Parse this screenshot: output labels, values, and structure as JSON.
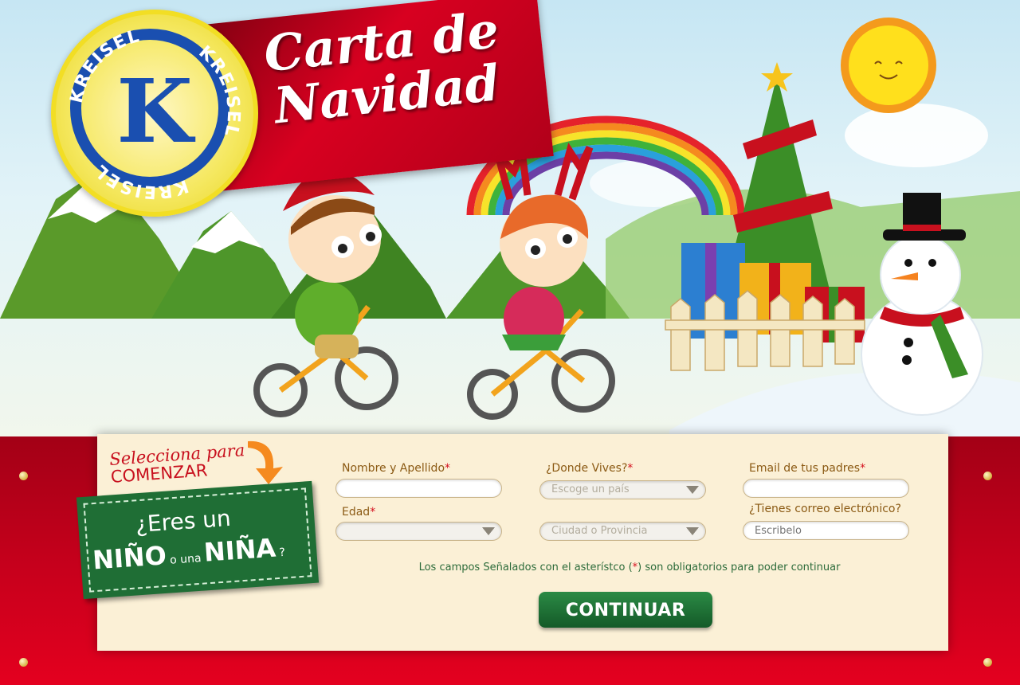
{
  "header": {
    "title_line1": "Carta de",
    "title_line2": "Navidad",
    "logo_text": "KREISEL",
    "logo_letter": "K"
  },
  "prompt": {
    "line1": "Selecciona para",
    "line2": "COMENZAR"
  },
  "gender_card": {
    "question": "¿Eres un",
    "boy": "NIÑO",
    "connector": "o una",
    "girl": "NIÑA",
    "qmark": "?"
  },
  "form": {
    "name_label": "Nombre y Apellido",
    "age_label": "Edad",
    "location_label": "¿Donde Vives?",
    "country_placeholder": "Escoge un país",
    "city_placeholder": "Ciudad o Provincia",
    "parents_email_label": "Email de tus padres",
    "own_email_label": "¿Tienes correo electrónico?",
    "own_email_placeholder": "Escribelo",
    "required_mark": "*"
  },
  "note": {
    "before": "Los campos Señalados con el asterístco (",
    "mark": "*",
    "after": ") son obligatorios para poder continuar"
  },
  "button": {
    "continue_label": "CONTINUAR"
  },
  "colors": {
    "brand_red": "#c8001c",
    "brand_green": "#1f6e35",
    "logo_blue": "#1a4fb0",
    "logo_yellow": "#f2de24"
  }
}
